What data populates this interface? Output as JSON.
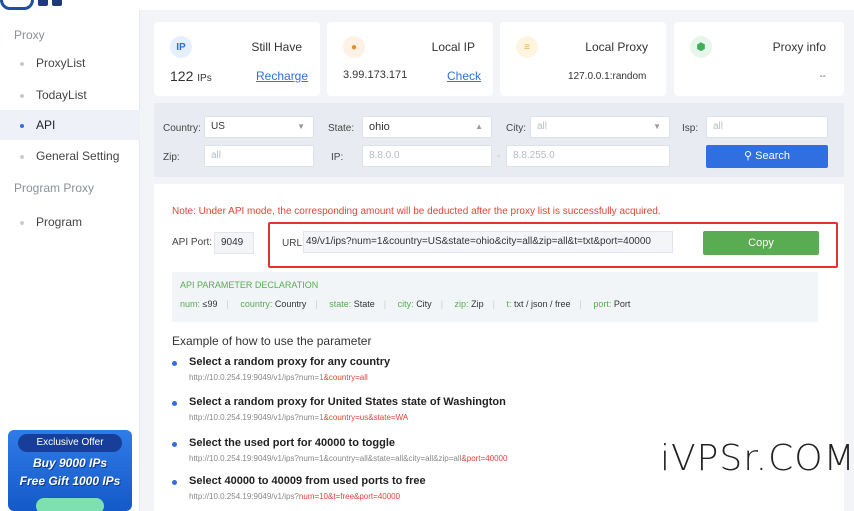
{
  "sidebar": {
    "groups": [
      {
        "label": "Proxy"
      },
      {
        "label": "Program Proxy"
      }
    ],
    "items": [
      {
        "label": "ProxyList"
      },
      {
        "label": "TodayList"
      },
      {
        "label": "API"
      },
      {
        "label": "General Setting"
      },
      {
        "label": "Program"
      }
    ],
    "promo": {
      "badge": "Exclusive Offer",
      "line1": "Buy 9000 IPs",
      "line2": "Free Gift 1000 IPs"
    }
  },
  "cards": {
    "ips": {
      "icon": "IP",
      "title": "Still Have",
      "count": "122",
      "unit": "IPs",
      "link": "Recharge"
    },
    "local_ip": {
      "title": "Local IP",
      "value": "3.99.173.171",
      "link": "Check"
    },
    "local_proxy": {
      "title": "Local Proxy",
      "value": "127.0.0.1:random"
    },
    "proxy_info": {
      "title": "Proxy info",
      "value": "--"
    }
  },
  "filters": {
    "country_label": "Country:",
    "country_value": "US",
    "state_label": "State:",
    "state_value": "ohio",
    "city_label": "City:",
    "city_value": "all",
    "isp_label": "Isp:",
    "isp_value": "all",
    "zip_label": "Zip:",
    "zip_value": "all",
    "ip_label": "IP:",
    "ip_from": "8.8.0.0",
    "ip_to": "8.8.255.0",
    "ip_dash": "-",
    "search_label": "Search"
  },
  "api": {
    "note": "Note: Under API mode, the corresponding amount will be deducted after the proxy list is successfully acquired.",
    "port_label": "API Port:",
    "port_value": "9049",
    "url_label": "URL:",
    "url_value": "49/v1/ips?num=1&country=US&state=ohio&city=all&zip=all&t=txt&port=40000",
    "copy_label": "Copy",
    "params_title": "API PARAMETER DECLARATION",
    "params": [
      {
        "key": "num:",
        "val": "≤99"
      },
      {
        "key": "country:",
        "val": "Country"
      },
      {
        "key": "state:",
        "val": "State"
      },
      {
        "key": "city:",
        "val": "City"
      },
      {
        "key": "zip:",
        "val": "Zip"
      },
      {
        "key": "t:",
        "val": "txt / json / free"
      },
      {
        "key": "port:",
        "val": "Port"
      }
    ]
  },
  "examples": {
    "title": "Example of how to use the parameter",
    "items": [
      {
        "title": "Select a random proxy for any country",
        "url_base": "http://10.0.254.19:9049/v1/ips?num=1",
        "url_hl": "&country=all"
      },
      {
        "title": "Select a random proxy for United States state of Washington",
        "url_base": "http://10.0.254.19:9049/v1/ips?num=1",
        "url_hl": "&country=us&state=WA"
      },
      {
        "title": "Select the used port for 40000 to toggle",
        "url_base": "http://10.0.254.19:9049/v1/ips?num=1&country=all&state=all&city=all&zip=all",
        "url_hl": "&port=40000"
      },
      {
        "title": "Select 40000 to 40009 from used ports to free",
        "url_base": "http://10.0.254.19:9049/v1/ips?",
        "url_hl": "num=10&t=free&port=40000"
      }
    ]
  },
  "watermark": "iVPSr.COM",
  "colors": {
    "accent": "#2f6fe0",
    "copy": "#5aac52",
    "alert": "#e0453a"
  }
}
